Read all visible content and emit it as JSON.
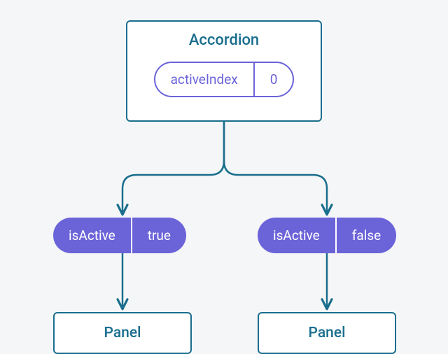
{
  "parent": {
    "title": "Accordion",
    "state": {
      "key": "activeIndex",
      "value": "0"
    }
  },
  "children": [
    {
      "prop": {
        "key": "isActive",
        "value": "true"
      },
      "label": "Panel"
    },
    {
      "prop": {
        "key": "isActive",
        "value": "false"
      },
      "label": "Panel"
    }
  ],
  "colors": {
    "line": "#1a6e8e",
    "accent": "#6b63d8",
    "bg": "#f5f6f7"
  }
}
